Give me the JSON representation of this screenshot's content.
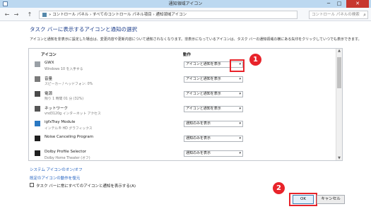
{
  "window": {
    "title": "通知領域アイコン",
    "min": "─",
    "max": "□",
    "close": "✕"
  },
  "address": {
    "back": "←",
    "forward": "→",
    "up": "↑",
    "breadcrumb": "» コントロール パネル › すべてのコントロール パネル項目 › 通知領域アイコン",
    "search_placeholder": "コントロール パネルの検索"
  },
  "main": {
    "heading": "タスク バーに表示するアイコンと通知の選択",
    "description": "アイコンと通知を非表示に設定した場合は、変更内容や更新内容について通知されなくなります。非表示になっているアイコンは、タスク バーの通知領域の横にある矢印をクリックしていつでも表示できます。",
    "columns": {
      "icon": "アイコン",
      "action": "動作"
    },
    "rows": [
      {
        "name": "GWX",
        "sub": "Windows 10 を入手する",
        "action": "アイコンと通知を表示",
        "color": "#9aa0a6"
      },
      {
        "name": "音量",
        "sub": "スピーカー / ヘッドフォン: 0%",
        "action": "アイコンと通知を表示",
        "color": "#7a7a7a"
      },
      {
        "name": "電源",
        "sub": "残り 1 時間 01 分 (32%)",
        "action": "アイコンと通知を表示",
        "color": "#4a4a4a"
      },
      {
        "name": "ネットワーク",
        "sub": "vnd3120g インターネット アクセス",
        "action": "アイコンと通知を表示",
        "color": "#555555"
      },
      {
        "name": "igfxTray Module",
        "sub": "インテル® HD グラフィックス",
        "action": "通知のみを表示",
        "color": "#2a78c2"
      },
      {
        "name": "Noise Canceling Program",
        "sub": "",
        "action": "通知のみを表示",
        "color": "#1f1f1f"
      },
      {
        "name": "Dolby Profile Selector",
        "sub": "Dolby Home Theater (オフ)",
        "action": "通知のみを表示",
        "color": "#202020"
      }
    ],
    "links": {
      "system_icons": "システム アイコンのオン/オフ",
      "restore_default": "既定のアイコンの動作を復元"
    },
    "always_show_label": "タスク バーに常にすべてのアイコンと通知を表示する(A)"
  },
  "buttons": {
    "ok": "OK",
    "cancel": "キャンセル"
  },
  "callouts": {
    "one": "1",
    "two": "2"
  },
  "colors": {
    "accent": "#e8232a",
    "link": "#1f5fbf",
    "heading": "#1e3f8c"
  }
}
